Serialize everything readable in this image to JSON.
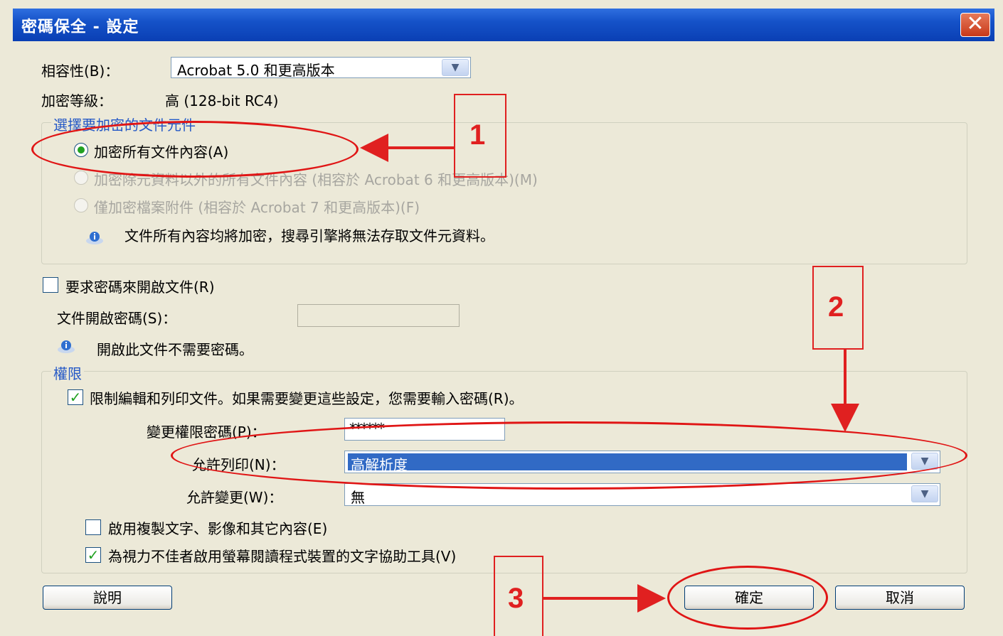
{
  "window": {
    "title": "密碼保全 - 設定",
    "close_glyph": "✕"
  },
  "compat": {
    "label": "相容性(B)：",
    "value": "Acrobat 5.0 和更高版本"
  },
  "encrypt_level": {
    "label": "加密等級：",
    "value": "高 (128-bit RC4)"
  },
  "components": {
    "legend": "選擇要加密的文件元件",
    "option_all": "加密所有文件內容(A)",
    "option_except_meta": "加密除元資料以外的所有文件內容 (相容於 Acrobat 6 和更高版本)(M)",
    "option_attach": "僅加密檔案附件 (相容於 Acrobat 7 和更高版本)(F)",
    "info": "文件所有內容均將加密，搜尋引擎將無法存取文件元資料。"
  },
  "open_password": {
    "checkbox_label": "要求密碼來開啟文件(R)",
    "checked": false,
    "field_label": "文件開啟密碼(S)：",
    "info": "開啟此文件不需要密碼。"
  },
  "permissions": {
    "legend": "權限",
    "restrict_label": "限制編輯和列印文件。如果需要變更這些設定，您需要輸入密碼(R)。",
    "restrict_checked": true,
    "change_password_label": "變更權限密碼(P)：",
    "change_password_value": "******",
    "print_label": "允許列印(N)：",
    "print_value": "高解析度",
    "change_label": "允許變更(W)：",
    "change_value": "無",
    "copy_label": "啟用複製文字、影像和其它內容(E)",
    "copy_checked": false,
    "access_label": "為視力不佳者啟用螢幕閱讀程式裝置的文字協助工具(V)",
    "access_checked": true
  },
  "buttons": {
    "help": "說明",
    "ok": "確定",
    "cancel": "取消"
  },
  "annotations": {
    "n1": "1",
    "n2": "2",
    "n3": "3"
  },
  "colors": {
    "annotation": "#e02020",
    "title_bar": "#0a3fb4",
    "checked": "#21a121"
  }
}
